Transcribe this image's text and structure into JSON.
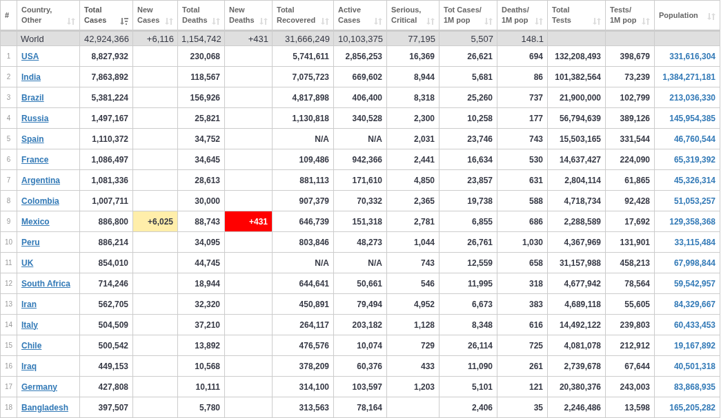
{
  "columns": [
    {
      "lines": [
        "#"
      ],
      "kind": "index"
    },
    {
      "lines": [
        "Country,",
        "Other"
      ],
      "sorted": false,
      "kind": "country"
    },
    {
      "lines": [
        "Total",
        "Cases"
      ],
      "sorted": true,
      "kind": "number"
    },
    {
      "lines": [
        "New",
        "Cases"
      ],
      "sorted": false,
      "kind": "new-cases"
    },
    {
      "lines": [
        "Total",
        "Deaths"
      ],
      "sorted": false,
      "kind": "number"
    },
    {
      "lines": [
        "New",
        "Deaths"
      ],
      "sorted": false,
      "kind": "new-deaths"
    },
    {
      "lines": [
        "Total",
        "Recovered"
      ],
      "sorted": false,
      "kind": "number"
    },
    {
      "lines": [
        "Active",
        "Cases"
      ],
      "sorted": false,
      "kind": "number"
    },
    {
      "lines": [
        "Serious,",
        "Critical"
      ],
      "sorted": false,
      "kind": "number"
    },
    {
      "lines": [
        "Tot Cases/",
        "1M pop"
      ],
      "sorted": false,
      "kind": "number"
    },
    {
      "lines": [
        "Deaths/",
        "1M pop"
      ],
      "sorted": false,
      "kind": "number"
    },
    {
      "lines": [
        "Total",
        "Tests"
      ],
      "sorted": false,
      "kind": "number"
    },
    {
      "lines": [
        "Tests/",
        "1M pop"
      ],
      "sorted": false,
      "kind": "number"
    },
    {
      "lines": [
        "Population"
      ],
      "sorted": false,
      "kind": "link"
    }
  ],
  "world": {
    "country": "World",
    "total_cases": "42,924,366",
    "new_cases": "+6,116",
    "total_deaths": "1,154,742",
    "new_deaths": "+431",
    "total_recovered": "31,666,249",
    "active_cases": "10,103,375",
    "serious": "77,195",
    "cases_per_1m": "5,507",
    "deaths_per_1m": "148.1"
  },
  "rows": [
    {
      "rank": "1",
      "country": "USA",
      "total_cases": "8,827,932",
      "total_deaths": "230,068",
      "total_recovered": "5,741,611",
      "active_cases": "2,856,253",
      "serious": "16,369",
      "cases_per_1m": "26,621",
      "deaths_per_1m": "694",
      "total_tests": "132,208,493",
      "tests_per_1m": "398,679",
      "population": "331,616,304"
    },
    {
      "rank": "2",
      "country": "India",
      "total_cases": "7,863,892",
      "total_deaths": "118,567",
      "total_recovered": "7,075,723",
      "active_cases": "669,602",
      "serious": "8,944",
      "cases_per_1m": "5,681",
      "deaths_per_1m": "86",
      "total_tests": "101,382,564",
      "tests_per_1m": "73,239",
      "population": "1,384,271,181"
    },
    {
      "rank": "3",
      "country": "Brazil",
      "total_cases": "5,381,224",
      "total_deaths": "156,926",
      "total_recovered": "4,817,898",
      "active_cases": "406,400",
      "serious": "8,318",
      "cases_per_1m": "25,260",
      "deaths_per_1m": "737",
      "total_tests": "21,900,000",
      "tests_per_1m": "102,799",
      "population": "213,036,330"
    },
    {
      "rank": "4",
      "country": "Russia",
      "total_cases": "1,497,167",
      "total_deaths": "25,821",
      "total_recovered": "1,130,818",
      "active_cases": "340,528",
      "serious": "2,300",
      "cases_per_1m": "10,258",
      "deaths_per_1m": "177",
      "total_tests": "56,794,639",
      "tests_per_1m": "389,126",
      "population": "145,954,385"
    },
    {
      "rank": "5",
      "country": "Spain",
      "total_cases": "1,110,372",
      "total_deaths": "34,752",
      "total_recovered": "N/A",
      "active_cases": "N/A",
      "serious": "2,031",
      "cases_per_1m": "23,746",
      "deaths_per_1m": "743",
      "total_tests": "15,503,165",
      "tests_per_1m": "331,544",
      "population": "46,760,544"
    },
    {
      "rank": "6",
      "country": "France",
      "total_cases": "1,086,497",
      "total_deaths": "34,645",
      "total_recovered": "109,486",
      "active_cases": "942,366",
      "serious": "2,441",
      "cases_per_1m": "16,634",
      "deaths_per_1m": "530",
      "total_tests": "14,637,427",
      "tests_per_1m": "224,090",
      "population": "65,319,392"
    },
    {
      "rank": "7",
      "country": "Argentina",
      "total_cases": "1,081,336",
      "total_deaths": "28,613",
      "total_recovered": "881,113",
      "active_cases": "171,610",
      "serious": "4,850",
      "cases_per_1m": "23,857",
      "deaths_per_1m": "631",
      "total_tests": "2,804,114",
      "tests_per_1m": "61,865",
      "population": "45,326,314"
    },
    {
      "rank": "8",
      "country": "Colombia",
      "total_cases": "1,007,711",
      "total_deaths": "30,000",
      "total_recovered": "907,379",
      "active_cases": "70,332",
      "serious": "2,365",
      "cases_per_1m": "19,738",
      "deaths_per_1m": "588",
      "total_tests": "4,718,734",
      "tests_per_1m": "92,428",
      "population": "51,053,257"
    },
    {
      "rank": "9",
      "country": "Mexico",
      "total_cases": "886,800",
      "new_cases": "+6,025",
      "total_deaths": "88,743",
      "new_deaths": "+431",
      "total_recovered": "646,739",
      "active_cases": "151,318",
      "serious": "2,781",
      "cases_per_1m": "6,855",
      "deaths_per_1m": "686",
      "total_tests": "2,288,589",
      "tests_per_1m": "17,692",
      "population": "129,358,368"
    },
    {
      "rank": "10",
      "country": "Peru",
      "total_cases": "886,214",
      "total_deaths": "34,095",
      "total_recovered": "803,846",
      "active_cases": "48,273",
      "serious": "1,044",
      "cases_per_1m": "26,761",
      "deaths_per_1m": "1,030",
      "total_tests": "4,367,969",
      "tests_per_1m": "131,901",
      "population": "33,115,484"
    },
    {
      "rank": "11",
      "country": "UK",
      "total_cases": "854,010",
      "total_deaths": "44,745",
      "total_recovered": "N/A",
      "active_cases": "N/A",
      "serious": "743",
      "cases_per_1m": "12,559",
      "deaths_per_1m": "658",
      "total_tests": "31,157,988",
      "tests_per_1m": "458,213",
      "population": "67,998,844"
    },
    {
      "rank": "12",
      "country": "South Africa",
      "total_cases": "714,246",
      "total_deaths": "18,944",
      "total_recovered": "644,641",
      "active_cases": "50,661",
      "serious": "546",
      "cases_per_1m": "11,995",
      "deaths_per_1m": "318",
      "total_tests": "4,677,942",
      "tests_per_1m": "78,564",
      "population": "59,542,957"
    },
    {
      "rank": "13",
      "country": "Iran",
      "total_cases": "562,705",
      "total_deaths": "32,320",
      "total_recovered": "450,891",
      "active_cases": "79,494",
      "serious": "4,952",
      "cases_per_1m": "6,673",
      "deaths_per_1m": "383",
      "total_tests": "4,689,118",
      "tests_per_1m": "55,605",
      "population": "84,329,667"
    },
    {
      "rank": "14",
      "country": "Italy",
      "total_cases": "504,509",
      "total_deaths": "37,210",
      "total_recovered": "264,117",
      "active_cases": "203,182",
      "serious": "1,128",
      "cases_per_1m": "8,348",
      "deaths_per_1m": "616",
      "total_tests": "14,492,122",
      "tests_per_1m": "239,803",
      "population": "60,433,453"
    },
    {
      "rank": "15",
      "country": "Chile",
      "total_cases": "500,542",
      "total_deaths": "13,892",
      "total_recovered": "476,576",
      "active_cases": "10,074",
      "serious": "729",
      "cases_per_1m": "26,114",
      "deaths_per_1m": "725",
      "total_tests": "4,081,078",
      "tests_per_1m": "212,912",
      "population": "19,167,892"
    },
    {
      "rank": "16",
      "country": "Iraq",
      "total_cases": "449,153",
      "total_deaths": "10,568",
      "total_recovered": "378,209",
      "active_cases": "60,376",
      "serious": "433",
      "cases_per_1m": "11,090",
      "deaths_per_1m": "261",
      "total_tests": "2,739,678",
      "tests_per_1m": "67,644",
      "population": "40,501,318"
    },
    {
      "rank": "17",
      "country": "Germany",
      "total_cases": "427,808",
      "total_deaths": "10,111",
      "total_recovered": "314,100",
      "active_cases": "103,597",
      "serious": "1,203",
      "cases_per_1m": "5,101",
      "deaths_per_1m": "121",
      "total_tests": "20,380,376",
      "tests_per_1m": "243,003",
      "population": "83,868,935"
    },
    {
      "rank": "18",
      "country": "Bangladesh",
      "total_cases": "397,507",
      "total_deaths": "5,780",
      "total_recovered": "313,563",
      "active_cases": "78,164",
      "cases_per_1m": "2,406",
      "deaths_per_1m": "35",
      "total_tests": "2,246,486",
      "tests_per_1m": "13,598",
      "population": "165,205,282"
    }
  ]
}
